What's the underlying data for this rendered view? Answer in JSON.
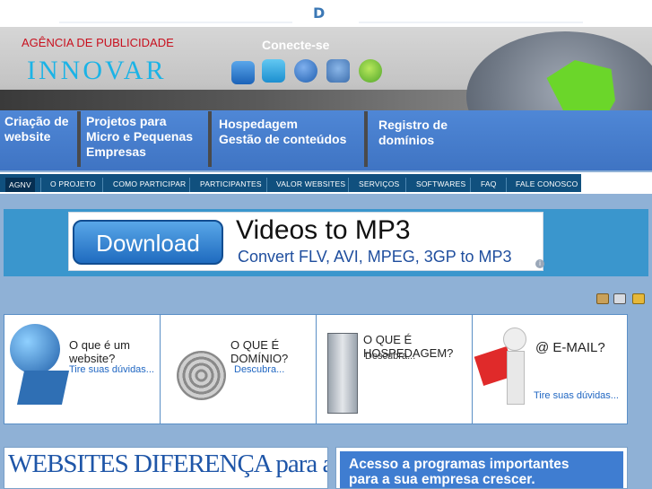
{
  "top": {
    "letter": "D"
  },
  "header": {
    "agency": "AGÊNCIA DE PUBLICIDADE",
    "logo_text": "INNOVAR",
    "connect_label": "Conecte-se",
    "social_icons": [
      "windows-live-icon",
      "twitter-icon",
      "facebook-icon",
      "users-icon",
      "skype-icon"
    ]
  },
  "nav_buttons": [
    {
      "line1": "Criação de",
      "line2": "website",
      "line3": ""
    },
    {
      "line1": "Projetos para",
      "line2": "Micro e Pequenas",
      "line3": "Empresas"
    },
    {
      "line1": "Hospedagem",
      "line2": "Gestão de conteúdos",
      "line3": ""
    },
    {
      "line1": "Registro de",
      "line2": "domínios",
      "line3": ""
    }
  ],
  "menu": [
    "AGNV",
    "O PROJETO",
    "COMO PARTICIPAR",
    "PARTICIPANTES",
    "VALOR WEBSITES",
    "SERVIÇOS",
    "SOFTWARES",
    "FAQ",
    "FALE CONOSCO"
  ],
  "ad": {
    "button": "Download",
    "title": "Videos to MP3",
    "subtitle": "Convert FLV, AVI, MPEG, 3GP to MP3",
    "info_icon": "info-icon"
  },
  "toolbar_icons": [
    "email-icon",
    "print-icon",
    "folder-icon"
  ],
  "cards": [
    {
      "title": "O que é um website?",
      "subtitle": "Tire suas dúvidas..."
    },
    {
      "title": "O QUE É DOMÍNIO?",
      "subtitle": "Descubra..."
    },
    {
      "title": "O QUE É HOSPEDAGEM?",
      "subtitle": "Descubra..."
    },
    {
      "title": "@ E-MAIL?",
      "subtitle": "Tire suas dúvidas..."
    }
  ],
  "bottom": {
    "left_text": "WEBSITES DIFERENÇA para a sua EMPRESA",
    "right_line1": "Acesso a programas importantes",
    "right_line2": "para a sua empresa crescer."
  }
}
